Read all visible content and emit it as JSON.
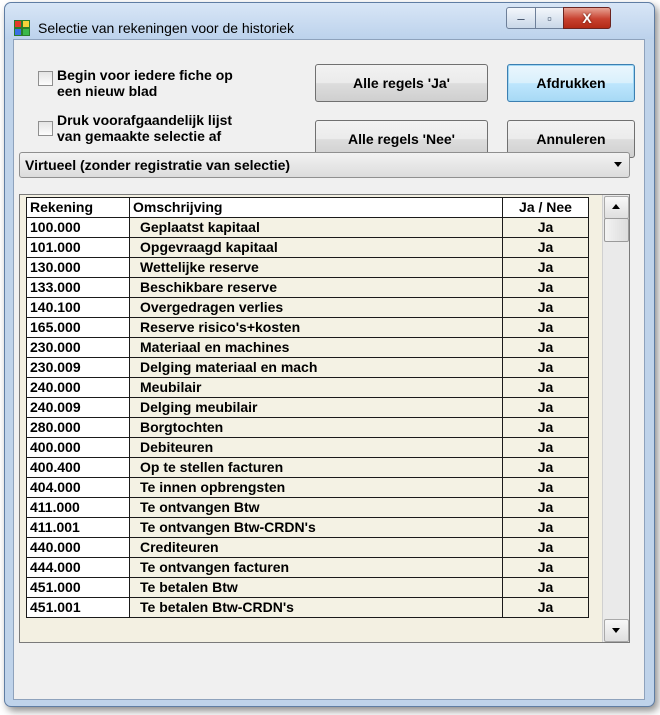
{
  "window": {
    "title": "Selectie van rekeningen voor de historiek",
    "min_glyph": "–",
    "max_glyph": "▫",
    "close_glyph": "X"
  },
  "options": {
    "new_page": {
      "line1": "Begin voor iedere fiche op",
      "line2": "een nieuw blad",
      "checked": false
    },
    "print_list": {
      "line1": "Druk voorafgaandelijk lijst",
      "line2": "van gemaakte selectie af",
      "checked": false
    }
  },
  "buttons": {
    "all_yes": "Alle regels 'Ja'",
    "all_no": "Alle regels 'Nee'",
    "print": "Afdrukken",
    "cancel": "Annuleren"
  },
  "mode_select": {
    "value": "Virtueel (zonder registratie van selectie)"
  },
  "table": {
    "columns": [
      "Rekening",
      "Omschrijving",
      "Ja / Nee"
    ],
    "rows": [
      {
        "account": "100.000",
        "description": "Geplaatst kapitaal",
        "value": "Ja"
      },
      {
        "account": "101.000",
        "description": "Opgevraagd kapitaal",
        "value": "Ja"
      },
      {
        "account": "130.000",
        "description": "Wettelijke reserve",
        "value": "Ja"
      },
      {
        "account": "133.000",
        "description": "Beschikbare reserve",
        "value": "Ja"
      },
      {
        "account": "140.100",
        "description": "Overgedragen verlies",
        "value": "Ja"
      },
      {
        "account": "165.000",
        "description": "Reserve risico's+kosten",
        "value": "Ja"
      },
      {
        "account": "230.000",
        "description": "Materiaal en machines",
        "value": "Ja"
      },
      {
        "account": "230.009",
        "description": "Delging materiaal en mach",
        "value": "Ja"
      },
      {
        "account": "240.000",
        "description": "Meubilair",
        "value": "Ja"
      },
      {
        "account": "240.009",
        "description": "Delging meubilair",
        "value": "Ja"
      },
      {
        "account": "280.000",
        "description": "Borgtochten",
        "value": "Ja"
      },
      {
        "account": "400.000",
        "description": "Debiteuren",
        "value": "Ja"
      },
      {
        "account": "400.400",
        "description": "Op te stellen facturen",
        "value": "Ja"
      },
      {
        "account": "404.000",
        "description": "Te innen opbrengsten",
        "value": "Ja"
      },
      {
        "account": "411.000",
        "description": "Te ontvangen Btw",
        "value": "Ja"
      },
      {
        "account": "411.001",
        "description": "Te ontvangen Btw-CRDN's",
        "value": "Ja"
      },
      {
        "account": "440.000",
        "description": "Crediteuren",
        "value": "Ja"
      },
      {
        "account": "444.000",
        "description": "Te ontvangen facturen",
        "value": "Ja"
      },
      {
        "account": "451.000",
        "description": "Te betalen Btw",
        "value": "Ja"
      },
      {
        "account": "451.001",
        "description": "Te betalen Btw-CRDN's",
        "value": "Ja"
      }
    ]
  },
  "colors": {
    "grid_bg": "#f4f2e4",
    "title_bg": "#bcd2ec",
    "close_red": "#c8412f"
  }
}
